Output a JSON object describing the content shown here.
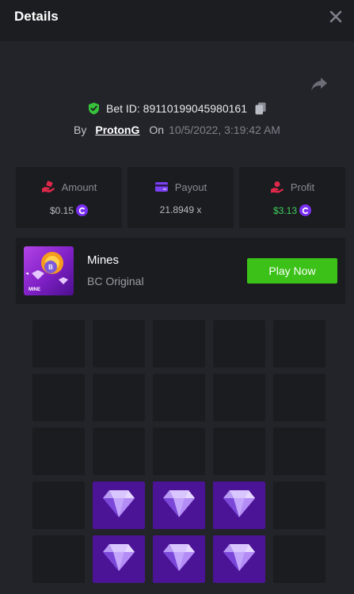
{
  "header": {
    "title": "Details",
    "close_icon": "close-icon"
  },
  "bet": {
    "id_label": "Bet ID: 89110199045980161",
    "by_label": "By",
    "user": "ProtonG",
    "on_label": "On",
    "date": "10/5/2022, 3:19:42 AM"
  },
  "stats": {
    "amount": {
      "label": "Amount",
      "value": "$0.15",
      "icon": "amount-hand-icon"
    },
    "payout": {
      "label": "Payout",
      "value": "21.8949 x",
      "icon": "wallet-icon"
    },
    "profit": {
      "label": "Profit",
      "value": "$3.13",
      "icon": "profit-hand-icon"
    }
  },
  "game": {
    "name": "Mines",
    "subtitle": "BC Original",
    "play_label": "Play Now",
    "thumb_text": "MINE"
  },
  "board": {
    "columns": 5,
    "rows": 5,
    "revealed_gems": [
      [
        3,
        1
      ],
      [
        3,
        2
      ],
      [
        3,
        3
      ],
      [
        4,
        1
      ],
      [
        4,
        2
      ],
      [
        4,
        3
      ]
    ]
  },
  "colors": {
    "background": "#232429",
    "card": "#1b1c20",
    "play_button": "#3bc117",
    "gem_tile": "#4b1395",
    "profit_text": "#3ed15d",
    "verified": "#36c23a"
  }
}
